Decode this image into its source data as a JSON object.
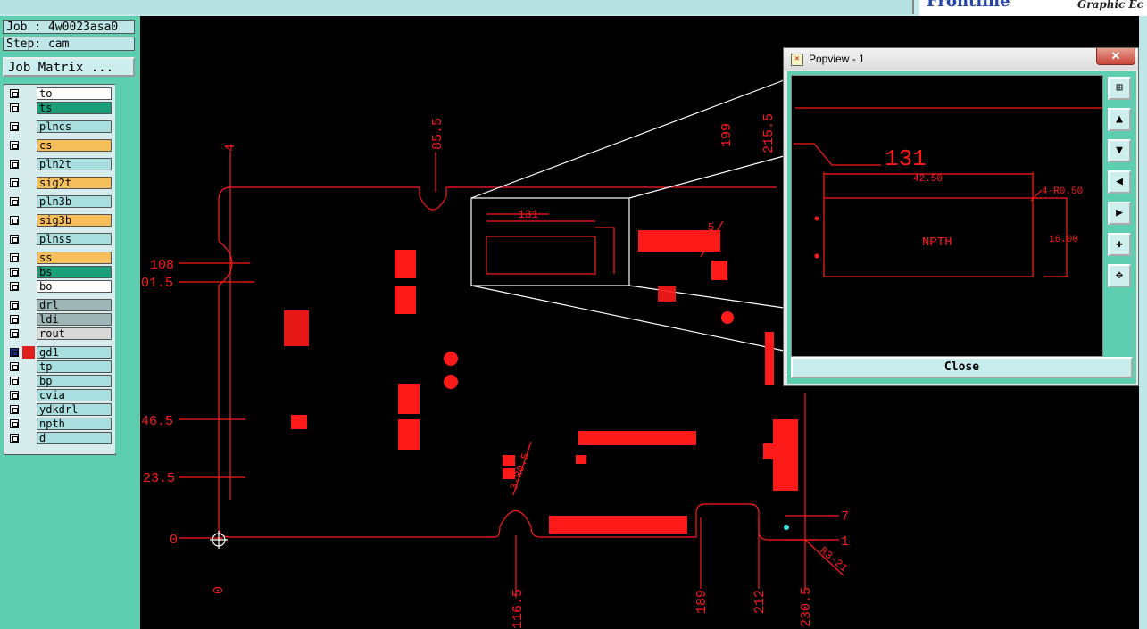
{
  "header": {
    "brand": "Frontline",
    "brand_sub": "Graphic Ec"
  },
  "job": {
    "job_label": "Job : 4w0023asa0",
    "step_label": "Step: cam",
    "matrix_button": "Job Matrix ..."
  },
  "layers": [
    {
      "name": "to",
      "color": "#ffffff"
    },
    {
      "name": "ts",
      "color": "#1a9e78"
    },
    {
      "name": "plncs",
      "color": "#a9dede"
    },
    {
      "name": "cs",
      "color": "#f5be5a"
    },
    {
      "name": "pln2t",
      "color": "#a9dede"
    },
    {
      "name": "sig2t",
      "color": "#f5be5a"
    },
    {
      "name": "pln3b",
      "color": "#a9dede"
    },
    {
      "name": "sig3b",
      "color": "#f5be5a"
    },
    {
      "name": "plnss",
      "color": "#a9dede"
    },
    {
      "name": "ss",
      "color": "#f5be5a"
    },
    {
      "name": "bs",
      "color": "#1a9e78"
    },
    {
      "name": "bo",
      "color": "#ffffff"
    },
    {
      "name": "drl",
      "color": "#9fb6b6"
    },
    {
      "name": "ldi",
      "color": "#9fb6b6"
    },
    {
      "name": "rout",
      "color": "#d8d8d8"
    },
    {
      "name": "gd1",
      "color": "#a9dede"
    },
    {
      "name": "tp",
      "color": "#a9dede"
    },
    {
      "name": "bp",
      "color": "#a9dede"
    },
    {
      "name": "cvia",
      "color": "#a9dede"
    },
    {
      "name": "ydkdrl",
      "color": "#a9dede"
    },
    {
      "name": "npth",
      "color": "#a9dede"
    },
    {
      "name": "d",
      "color": "#a9dede"
    }
  ],
  "dims": {
    "top": [
      "4",
      "85.5",
      "199",
      "215.5"
    ],
    "left": [
      "108",
      "01.5",
      "46.5",
      "23.5",
      "0"
    ],
    "bottom": [
      "0",
      "116.5",
      "189",
      "212",
      "230.5"
    ],
    "right": [
      "7",
      "1"
    ],
    "callouts": [
      "131",
      "3-R0.5",
      "R3-21",
      "5"
    ]
  },
  "popup": {
    "title": "Popview - 1",
    "close_x": "✕",
    "close_label": "Close",
    "detail": {
      "ref": "131",
      "width": "42.50",
      "radius": "4-R0.50",
      "height": "16.00",
      "label": "NPTH"
    }
  },
  "colors": {
    "accent": "#5dcfb0",
    "pcb": "#ff1010",
    "panel": "#bfe6e6"
  }
}
